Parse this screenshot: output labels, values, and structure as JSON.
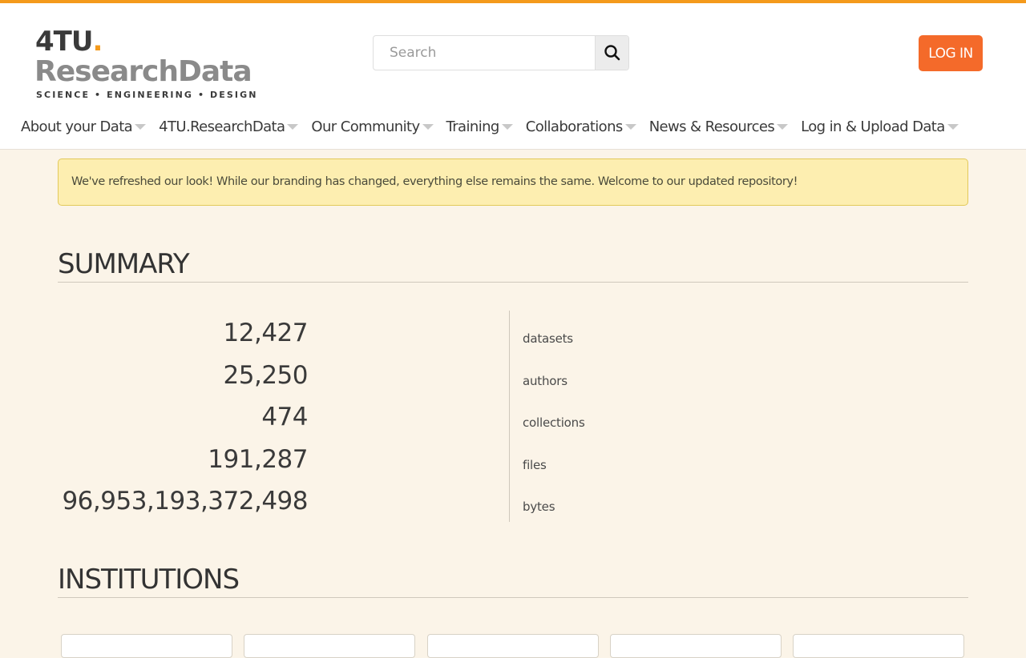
{
  "header": {
    "logo": {
      "line1": "4TU",
      "dot": ".",
      "line2": "ResearchData",
      "tagline": "SCIENCE • ENGINEERING • DESIGN"
    },
    "search": {
      "placeholder": "Search",
      "icon": "search-icon"
    },
    "login_label": "LOG IN",
    "accent_color": "#f49a1c",
    "login_color": "#f46a2a"
  },
  "nav": {
    "items": [
      {
        "label": "About your Data"
      },
      {
        "label": "4TU.ResearchData"
      },
      {
        "label": "Our Community"
      },
      {
        "label": "Training"
      },
      {
        "label": "Collaborations"
      },
      {
        "label": "News & Resources"
      },
      {
        "label": "Log in & Upload Data"
      }
    ]
  },
  "notice": {
    "text": "We've refreshed our look! While our branding has changed, everything else remains the same. Welcome to our updated repository!"
  },
  "summary": {
    "title": "SUMMARY",
    "stats": [
      {
        "value": "12,427",
        "label": "datasets"
      },
      {
        "value": "25,250",
        "label": "authors"
      },
      {
        "value": "474",
        "label": "collections"
      },
      {
        "value": "191,287",
        "label": "files"
      },
      {
        "value": "96,953,193,372,498",
        "label": "bytes"
      }
    ]
  },
  "institutions": {
    "title": "INSTITUTIONS"
  }
}
